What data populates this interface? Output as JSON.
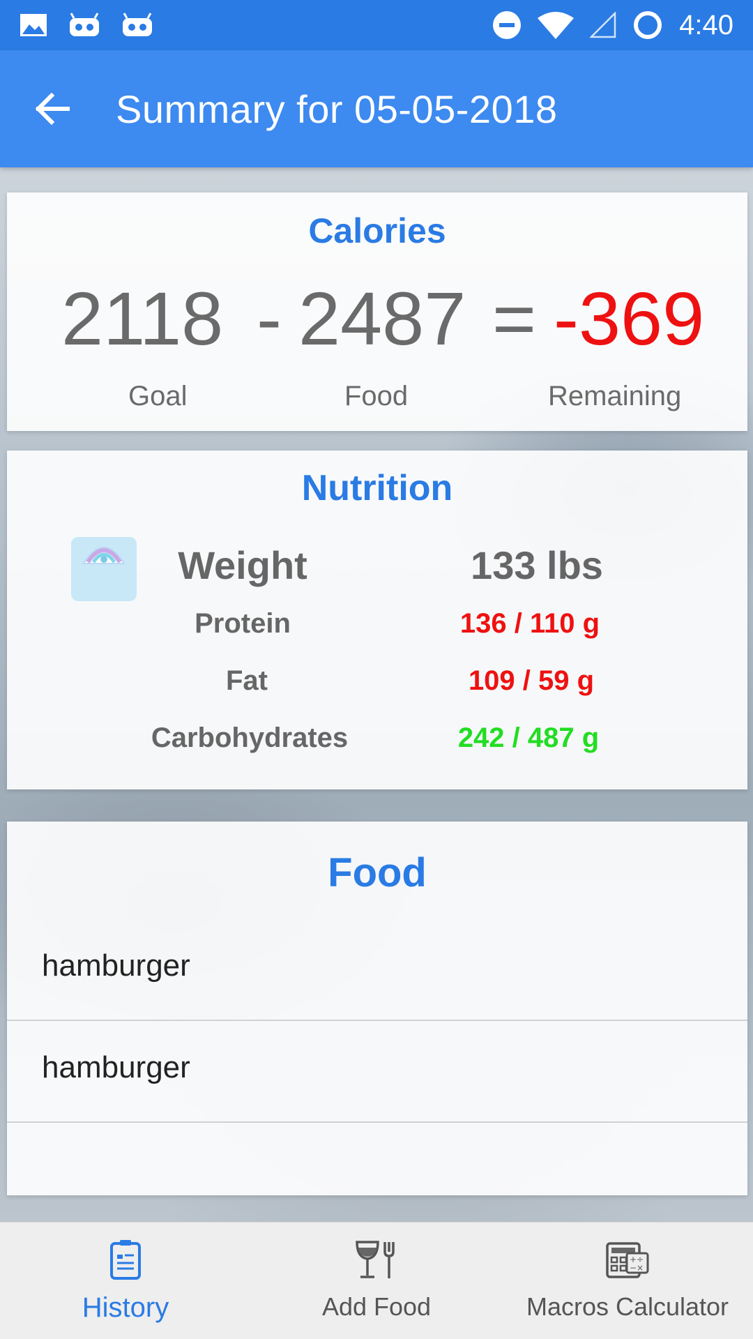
{
  "status_bar": {
    "time": "4:40",
    "icons": [
      "image-icon",
      "android-icon",
      "android-icon",
      "do-not-disturb-icon",
      "wifi-icon",
      "signal-icon",
      "loading-ring-icon"
    ]
  },
  "app_bar": {
    "title": "Summary for 05-05-2018",
    "back_icon": "arrow-left-icon"
  },
  "calories": {
    "title": "Calories",
    "goal": "2118",
    "minus": "-",
    "food": "2487",
    "equals": "=",
    "remaining": "-369",
    "goal_label": "Goal",
    "food_label": "Food",
    "remaining_label": "Remaining",
    "remaining_color": "#ee1111"
  },
  "nutrition": {
    "title": "Nutrition",
    "icon": "scale-icon",
    "weight_label": "Weight",
    "weight_value": "133 lbs",
    "rows": [
      {
        "label": "Protein",
        "value": "136 / 110 g",
        "color": "#ee1111"
      },
      {
        "label": "Fat",
        "value": "109 / 59 g",
        "color": "#ee1111"
      },
      {
        "label": "Carbohydrates",
        "value": "242 / 487 g",
        "color": "#22dd22"
      }
    ]
  },
  "food": {
    "title": "Food",
    "items": [
      "hamburger",
      "hamburger"
    ]
  },
  "bottom_nav": {
    "items": [
      {
        "label": "History",
        "icon": "history-icon",
        "active": true
      },
      {
        "label": "Add Food",
        "icon": "add-food-icon",
        "active": false
      },
      {
        "label": "Macros Calculator",
        "icon": "calculator-icon",
        "active": false
      }
    ],
    "active_color": "#2a7be4",
    "inactive_color": "#555555"
  },
  "colors": {
    "primary": "#3d8af0",
    "status_bar": "#2a7be4",
    "card_title": "#2a7be4"
  }
}
